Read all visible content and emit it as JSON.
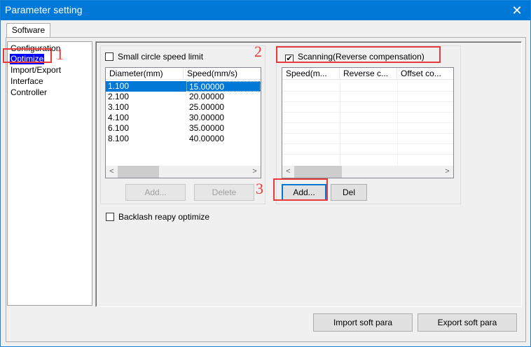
{
  "window": {
    "title": "Parameter setting",
    "close_glyph": "✕"
  },
  "tabs": [
    {
      "label": "Software"
    }
  ],
  "tree": {
    "items": [
      {
        "label": "Configuration"
      },
      {
        "label": "Optimize"
      },
      {
        "label": "Import/Export"
      },
      {
        "label": "Interface"
      },
      {
        "label": "Controller"
      }
    ]
  },
  "small_circle": {
    "checkbox_label": "Small circle speed limit",
    "checked": false,
    "columns": [
      "Diameter(mm)",
      "Speed(mm/s)"
    ],
    "rows": [
      {
        "diameter": "1.100",
        "speed": "15.00000",
        "selected": true
      },
      {
        "diameter": "2.100",
        "speed": "20.00000"
      },
      {
        "diameter": "3.100",
        "speed": "25.00000"
      },
      {
        "diameter": "4.100",
        "speed": "30.00000"
      },
      {
        "diameter": "6.100",
        "speed": "35.00000"
      },
      {
        "diameter": "8.100",
        "speed": "40.00000"
      }
    ],
    "add_label": "Add...",
    "delete_label": "Delete"
  },
  "scanning": {
    "checkbox_label": "Scanning(Reverse compensation)",
    "checked": true,
    "check_glyph": "✔",
    "columns": [
      "Speed(m...",
      "Reverse c...",
      "Offset co..."
    ],
    "add_label": "Add...",
    "del_label": "Del"
  },
  "backlash": {
    "checkbox_label": "Backlash reapy optimize",
    "checked": false
  },
  "footer": {
    "import_label": "Import soft para",
    "export_label": "Export soft para"
  },
  "annotations": {
    "n1": "1",
    "n2": "2",
    "n3": "3",
    "color": "#e83a3a"
  },
  "scroll": {
    "left_glyph": "<",
    "right_glyph": ">"
  }
}
